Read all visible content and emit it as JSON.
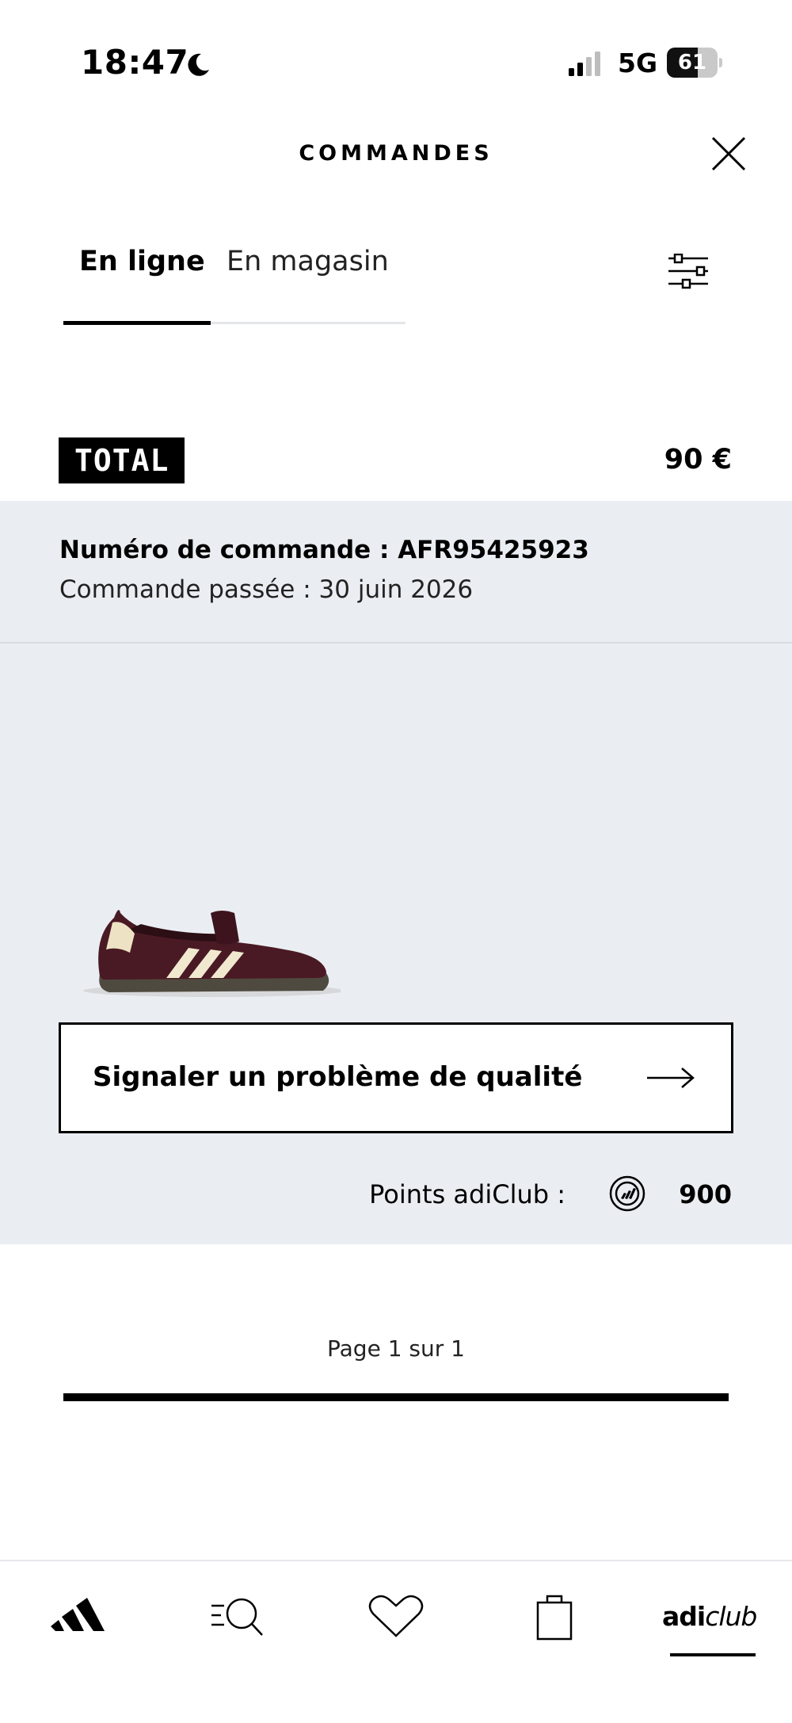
{
  "status_bar": {
    "time": "18:47",
    "network": "5G",
    "battery_percent": 61,
    "battery_label": "61"
  },
  "header": {
    "title": "COMMANDES"
  },
  "tabs": [
    {
      "label": "En ligne",
      "active": true
    },
    {
      "label": "En magasin",
      "active": false
    }
  ],
  "total": {
    "label": "TOTAL",
    "amount": "90 €"
  },
  "order": {
    "number": "Numéro de commande : AFR95425923",
    "date": "Commande passée : 30 juin 2026",
    "quality_button_label": "Signaler un problème de qualité",
    "points_label": "Points adiClub :",
    "points_value": "900"
  },
  "pagination": {
    "label": "Page 1 sur 1",
    "progress": 1.0
  },
  "bottom_nav": {
    "items": [
      {
        "icon": "adidas-logo-icon"
      },
      {
        "icon": "search-icon"
      },
      {
        "icon": "heart-icon"
      },
      {
        "icon": "shopping-bag-icon"
      },
      {
        "label_bold": "adi",
        "label_italic": "club",
        "active": true
      }
    ]
  },
  "colors": {
    "panel_background": "#eaeef2",
    "shoe_primary": "#4a1a24",
    "shoe_stripes": "#f1e9cf",
    "shoe_sole": "#4f4a3f"
  }
}
